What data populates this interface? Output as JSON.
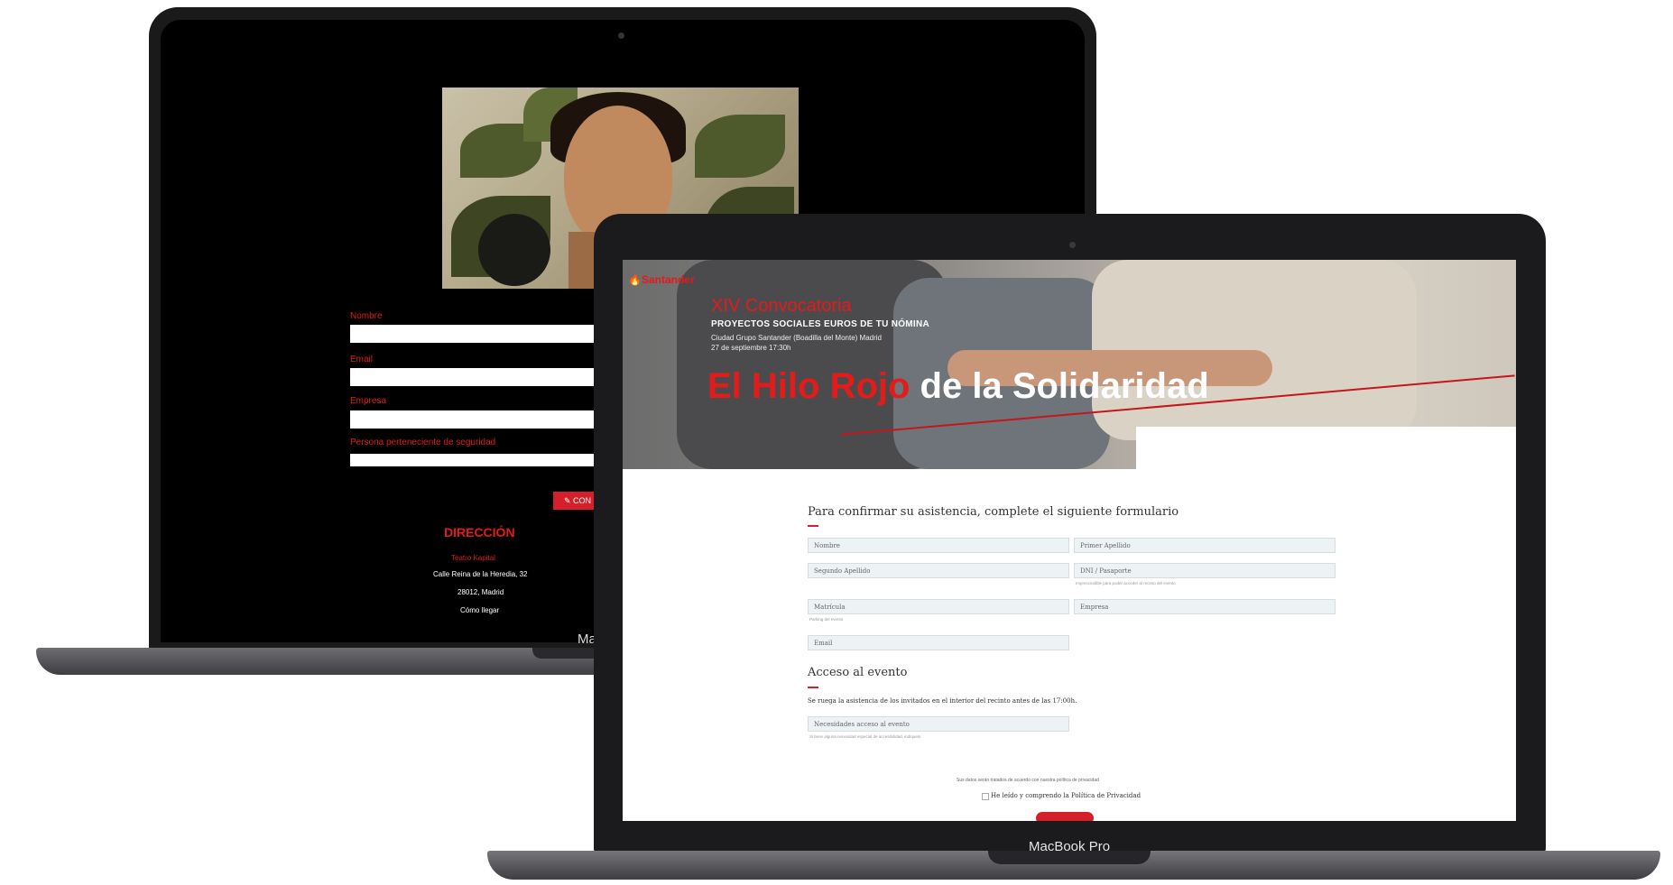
{
  "back_site": {
    "fields": [
      {
        "label": "Nombre"
      },
      {
        "label": "Email"
      },
      {
        "label": "Empresa"
      },
      {
        "label": "Persona perteneciente de seguridad"
      }
    ],
    "confirm_button": "CON",
    "direccion_title": "DIRECCIÓN",
    "address": {
      "line1": "Teatro Kapital",
      "line2": "Calle Reina de la Heredia, 32",
      "line3": "28012, Madrid",
      "line4": "Cómo llegar"
    },
    "laptop_label": "Ma"
  },
  "front_site": {
    "brand": "Santander",
    "banner": {
      "convocatoria": "XIV Convocatoria",
      "subtitle": "PROYECTOS SOCIALES EUROS DE TU NÓMINA",
      "line1": "Ciudad Grupo Santander (Boadilla del Monte) Madrid",
      "line2": "27 de septiembre 17:30h",
      "title_red": "El Hilo Rojo",
      "title_white": " de la Solidaridad"
    },
    "form": {
      "title": "Para confirmar su asistencia, complete el siguiente formulario",
      "placeholders": {
        "nombre": "Nombre",
        "primer_apellido": "Primer Apellido",
        "segundo_apellido": "Segundo Apellido",
        "dni": "DNI / Pasaporte",
        "matricula": "Matrícula",
        "empresa": "Empresa",
        "email": "Email",
        "accesibilidad": "Necesidades acceso al evento"
      },
      "dni_hint": "Imprescindible para poder acceder al recinto del evento",
      "matricula_hint": "Parking del evento",
      "acceso_title": "Acceso al evento",
      "ruego_text": "Se ruega la asistencia de los invitados en el interior del recinto antes de las 17:00h.",
      "acceso_hint": "Si tiene alguna necesidad especial de accesibilidad, indíquelo",
      "privacy_note": "Sus datos serán tratados de acuerdo con nuestra política de privacidad",
      "accept_label": "He leído y comprendo la Política de Privacidad"
    },
    "laptop_label": "MacBook Pro"
  },
  "colors": {
    "brand_red": "#e21b1b",
    "button_red": "#d4202a"
  }
}
